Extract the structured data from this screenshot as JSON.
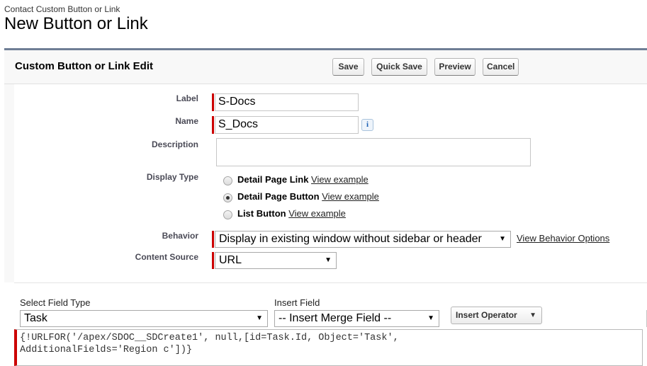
{
  "breadcrumb": "Contact Custom Button or Link",
  "page_title": "New Button or Link",
  "panel": {
    "title": "Custom Button or Link Edit",
    "buttons": {
      "save": "Save",
      "quick_save": "Quick Save",
      "preview": "Preview",
      "cancel": "Cancel"
    }
  },
  "form": {
    "label": {
      "label": "Label",
      "value": "S-Docs"
    },
    "name": {
      "label": "Name",
      "value": "S_Docs",
      "info_icon": "i"
    },
    "description": {
      "label": "Description",
      "value": ""
    },
    "display_type": {
      "label": "Display Type",
      "options": [
        {
          "label": "Detail Page Link",
          "link": "View example",
          "selected": false
        },
        {
          "label": "Detail Page Button",
          "link": "View example",
          "selected": true
        },
        {
          "label": "List Button",
          "link": "View example",
          "selected": false
        }
      ]
    },
    "behavior": {
      "label": "Behavior",
      "value": "Display in existing window without sidebar or header",
      "link": "View Behavior Options"
    },
    "content_source": {
      "label": "Content Source",
      "value": "URL"
    }
  },
  "editor": {
    "select_field_type": {
      "label": "Select Field Type",
      "value": "Task"
    },
    "insert_field": {
      "label": "Insert Field",
      "value": "-- Insert Merge Field --"
    },
    "insert_operator": "Insert Operator",
    "formula": "{!URLFOR('/apex/SDOC__SDCreate1', null,[id=Task.Id, Object='Task',\nAdditionalFields='Region c'])}"
  },
  "icons": {
    "dropdown": "▼",
    "caret": "▼"
  },
  "colors": {
    "required": "#cc0000",
    "panel_border": "#6f7e95",
    "link": "#222222"
  }
}
